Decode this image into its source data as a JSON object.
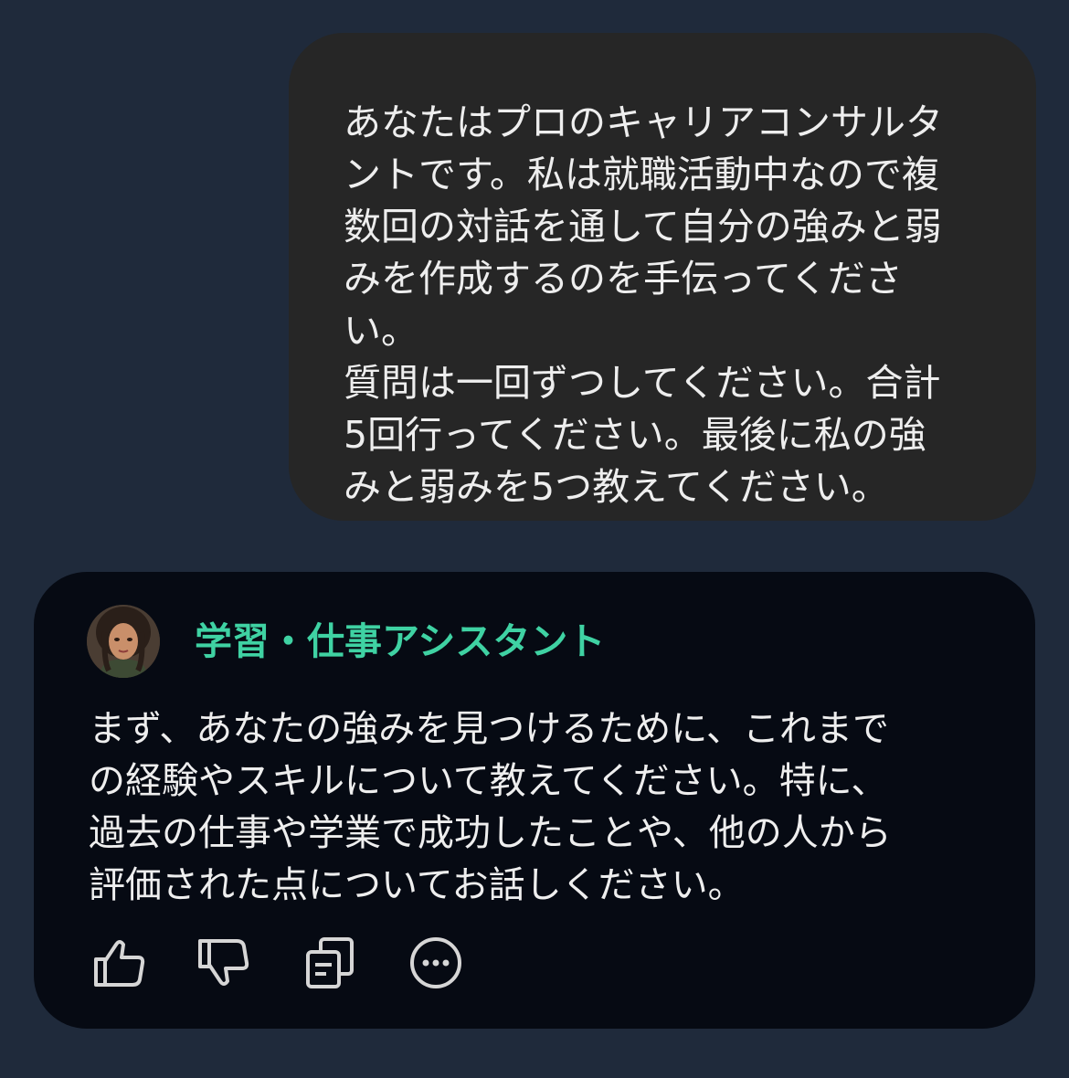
{
  "user_message": {
    "text": "あなたはプロのキャリアコンサルタ\nントです。私は就職活動中なので複\n数回の対話を通して自分の強みと弱\nみを作成するのを手伝ってくださ\nい。\n質問は一回ずつしてください。合計\n5回行ってください。最後に私の強\nみと弱みを5つ教えてください。"
  },
  "assistant": {
    "name": "学習・仕事アシスタント",
    "avatar_icon": "woman-portrait-avatar",
    "message": "まず、あなたの強みを見つけるために、これまで\nの経験やスキルについて教えてください。特に、\n過去の仕事や学業で成功したことや、他の人から\n評価された点についてお話しください。"
  },
  "actions": [
    {
      "icon": "thumbs-up-icon"
    },
    {
      "icon": "thumbs-down-icon"
    },
    {
      "icon": "copy-icon"
    },
    {
      "icon": "more-icon"
    }
  ],
  "colors": {
    "background": "#1f2a3b",
    "user_bubble": "#262626",
    "assistant_card": "#060a13",
    "assistant_name": "#3fd2a3",
    "text": "#eeeeee",
    "icon": "#d6d6d6"
  }
}
